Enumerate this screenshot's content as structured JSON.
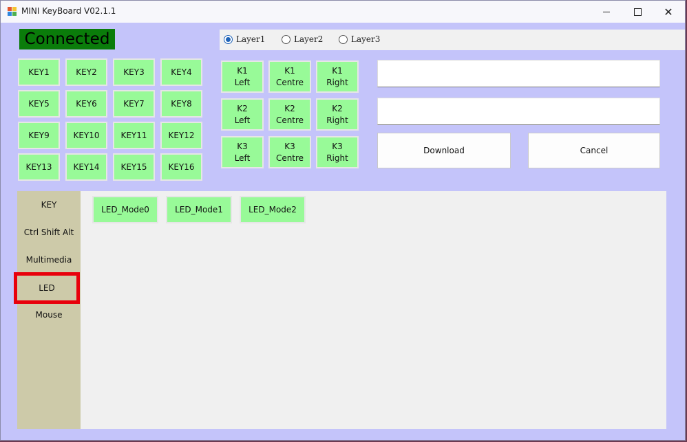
{
  "window": {
    "title": "MINI KeyBoard V02.1.1",
    "controls": {
      "minimize": "–",
      "maximize": "☐",
      "close": "✕"
    }
  },
  "status": {
    "label": "Connected",
    "color": "#0a7c0a"
  },
  "layers": [
    {
      "label": "Layer1",
      "selected": true
    },
    {
      "label": "Layer2",
      "selected": false
    },
    {
      "label": "Layer3",
      "selected": false
    }
  ],
  "keys": [
    "KEY1",
    "KEY2",
    "KEY3",
    "KEY4",
    "KEY5",
    "KEY6",
    "KEY7",
    "KEY8",
    "KEY9",
    "KEY10",
    "KEY11",
    "KEY12",
    "KEY13",
    "KEY14",
    "KEY15",
    "KEY16"
  ],
  "knobs": [
    [
      "K1\nLeft",
      "K1\nCentre",
      "K1\nRight"
    ],
    [
      "K2\nLeft",
      "K2\nCentre",
      "K2\nRight"
    ],
    [
      "K3\nLeft",
      "K3\nCentre",
      "K3\nRight"
    ]
  ],
  "fields": {
    "field1_value": "",
    "field2_value": ""
  },
  "actions": {
    "download": "Download",
    "cancel": "Cancel"
  },
  "tabs": [
    {
      "label": "KEY"
    },
    {
      "label": "Ctrl Shift Alt"
    },
    {
      "label": "Multimedia"
    },
    {
      "label": "LED",
      "selected": true
    },
    {
      "label": "Mouse"
    }
  ],
  "led_modes": [
    "LED_Mode0",
    "LED_Mode1",
    "LED_Mode2"
  ],
  "colors": {
    "button_green": "#98fa98",
    "window_bg": "#c4c4fa",
    "tab_strip": "#cdcaa9",
    "highlight": "#e8000b"
  }
}
